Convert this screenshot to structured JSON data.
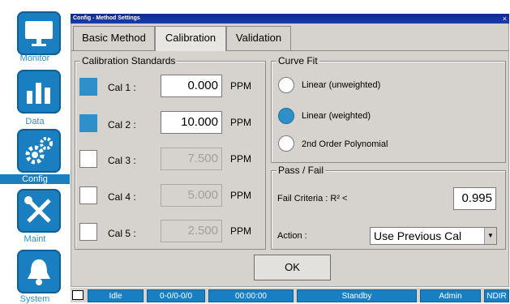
{
  "nav": [
    {
      "label": "Monitor",
      "icon": "monitor-icon"
    },
    {
      "label": "Data",
      "icon": "bar-chart-icon"
    },
    {
      "label": "Config",
      "icon": "gears-icon",
      "selected": true
    },
    {
      "label": "Maint",
      "icon": "wrench-screwdriver-icon"
    },
    {
      "label": "System",
      "icon": "bell-icon"
    }
  ],
  "dialog": {
    "title": "Config - Method Settings",
    "close": "×"
  },
  "tabs": [
    {
      "label": "Basic Method"
    },
    {
      "label": "Calibration",
      "active": true
    },
    {
      "label": "Validation"
    }
  ],
  "cal_standards": {
    "title": "Calibration Standards",
    "unit": "PPM",
    "rows": [
      {
        "label": "Cal 1 :",
        "value": "0.000",
        "checked": true,
        "enabled": true
      },
      {
        "label": "Cal 2 :",
        "value": "10.000",
        "checked": true,
        "enabled": true
      },
      {
        "label": "Cal 3 :",
        "value": "7.500",
        "checked": false,
        "enabled": false
      },
      {
        "label": "Cal 4 :",
        "value": "5.000",
        "checked": false,
        "enabled": false
      },
      {
        "label": "Cal 5 :",
        "value": "2.500",
        "checked": false,
        "enabled": false
      }
    ]
  },
  "curve_fit": {
    "title": "Curve Fit",
    "options": [
      {
        "label": "Linear (unweighted)",
        "selected": false
      },
      {
        "label": "Linear (weighted)",
        "selected": true
      },
      {
        "label": "2nd Order Polynomial",
        "selected": false
      }
    ]
  },
  "pass_fail": {
    "title": "Pass / Fail",
    "criteria_label": "Fail Criteria : R² <",
    "criteria_value": "0.995",
    "action_label": "Action :",
    "action_value": "Use Previous Cal"
  },
  "ok_label": "OK",
  "status": [
    "Idle",
    "0-0/0-0/0",
    "00:00:00",
    "Standby",
    "Admin",
    "NDIR"
  ],
  "colors": {
    "accent": "#1a7fc1",
    "checked": "#2f8fc9",
    "dialog_bg": "#d6d3ce"
  }
}
